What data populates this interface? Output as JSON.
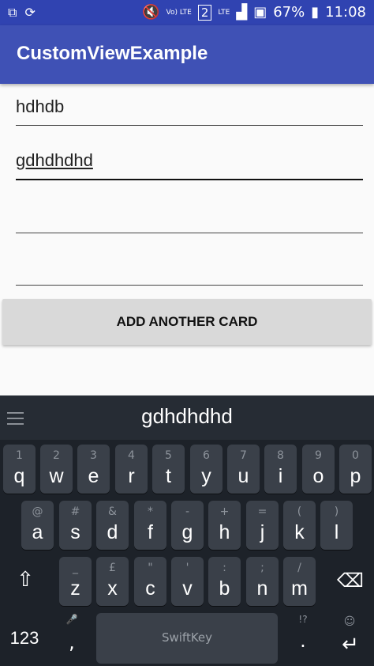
{
  "status_bar": {
    "left_icons": [
      "screenshot-icon",
      "sync-icon"
    ],
    "volte": "Vo) LTE",
    "sim": "2",
    "lte": "LTE",
    "battery": "67%",
    "time": "11:08"
  },
  "app_bar": {
    "title": "CustomViewExample"
  },
  "fields": [
    {
      "value": "hdhdb"
    },
    {
      "value": "gdhdhdhd"
    },
    {
      "value": ""
    },
    {
      "value": ""
    }
  ],
  "add_button": {
    "label": "ADD ANOTHER CARD"
  },
  "keyboard": {
    "suggestion": "gdhdhdhd",
    "row1": [
      {
        "sub": "1",
        "main": "q"
      },
      {
        "sub": "2",
        "main": "w"
      },
      {
        "sub": "3",
        "main": "e"
      },
      {
        "sub": "4",
        "main": "r"
      },
      {
        "sub": "5",
        "main": "t"
      },
      {
        "sub": "6",
        "main": "y"
      },
      {
        "sub": "7",
        "main": "u"
      },
      {
        "sub": "8",
        "main": "i"
      },
      {
        "sub": "9",
        "main": "o"
      },
      {
        "sub": "0",
        "main": "p"
      }
    ],
    "row2": [
      {
        "sub": "@",
        "main": "a"
      },
      {
        "sub": "#",
        "main": "s"
      },
      {
        "sub": "&",
        "main": "d"
      },
      {
        "sub": "*",
        "main": "f"
      },
      {
        "sub": "-",
        "main": "g"
      },
      {
        "sub": "+",
        "main": "h"
      },
      {
        "sub": "=",
        "main": "j"
      },
      {
        "sub": "(",
        "main": "k"
      },
      {
        "sub": ")",
        "main": "l"
      }
    ],
    "row3": [
      {
        "sub": "_",
        "main": "z"
      },
      {
        "sub": "£",
        "main": "x"
      },
      {
        "sub": "\"",
        "main": "c"
      },
      {
        "sub": "'",
        "main": "v"
      },
      {
        "sub": ":",
        "main": "b"
      },
      {
        "sub": ";",
        "main": "n"
      },
      {
        "sub": "/",
        "main": "m"
      }
    ],
    "numbers_key": "123",
    "comma_sub": "🎤",
    "comma": ",",
    "space_brand": "SwiftKey",
    "period_sub": "!?",
    "period": ".",
    "emoji_icon": "smiley-icon",
    "shift_icon": "shift-icon",
    "backspace_icon": "backspace-icon",
    "enter_icon": "enter-icon"
  }
}
